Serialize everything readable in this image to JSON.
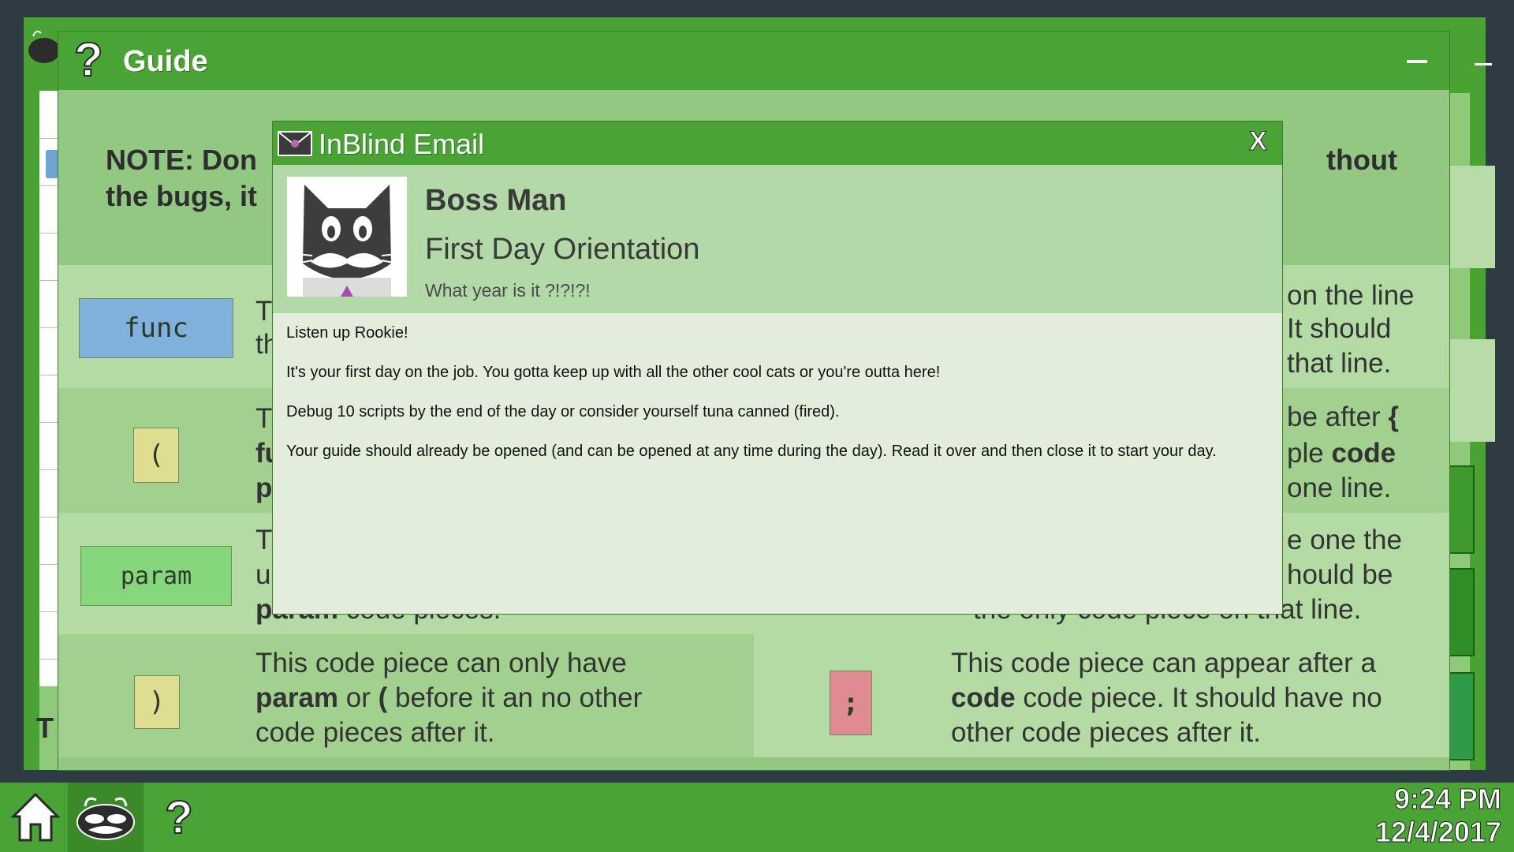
{
  "guide": {
    "title": "Guide",
    "note_left_line1": "NOTE: Don",
    "note_left_line2": "the bugs, it",
    "note_right": "thout",
    "cells": {
      "func": {
        "piece": "func",
        "line1": "T",
        "line2": "th",
        "right_line1": "on the line",
        "right_line2": "It should",
        "right_line3": "that line."
      },
      "open_paren": {
        "piece": "(",
        "line1": "T",
        "line2": "fu",
        "line3": "p",
        "right_line1_a": "be after ",
        "right_line1_b": "{",
        "right_line2_a": "ple ",
        "right_line2_b": "code",
        "right_line3": "one line."
      },
      "param": {
        "piece": "param",
        "line1": "T",
        "line2": "u",
        "line3_a": "param",
        "line3_b": " code pieces.",
        "right_line1": "e one the",
        "right_line2": "hould be",
        "right_line3": "the only code piece on that line."
      },
      "close_paren": {
        "piece": ")",
        "line1": "This code piece can only have",
        "line2_a": "param",
        "line2_b": " or ",
        "line2_c": "(",
        "line2_d": " before it an no other",
        "line3": "code pieces after it."
      },
      "semicolon": {
        "piece": ";",
        "line1": "This code piece can appear after a",
        "line2_a": "code",
        "line2_b": " code piece. It should have no",
        "line3": "other code pieces after it."
      }
    }
  },
  "email": {
    "app_title": "InBlind Email",
    "close_label": "X",
    "sender": "Boss Man",
    "subject": "First Day Orientation",
    "preview": "What year is it ?!?!?!",
    "body": [
      "Listen up Rookie!",
      "It's your first day on the job. You gotta keep up with all the other cool cats or you're outta here!",
      "Debug 10 scripts by the end of the day or consider yourself tuna canned (fired).",
      "Your guide should already be opened (and can be opened at any time during the day). Read it over and then close it to start your day."
    ]
  },
  "back_window": {
    "label": "T"
  },
  "taskbar": {
    "help_label": "?",
    "time": "9:24 PM",
    "date": "12/4/2017"
  },
  "colors": {
    "title_green": "#4aa335",
    "func_blue": "#7fb1dc",
    "paren_yellow": "#dedd90",
    "param_green": "#86d77c",
    "semicolon_pink": "#e08a92"
  }
}
